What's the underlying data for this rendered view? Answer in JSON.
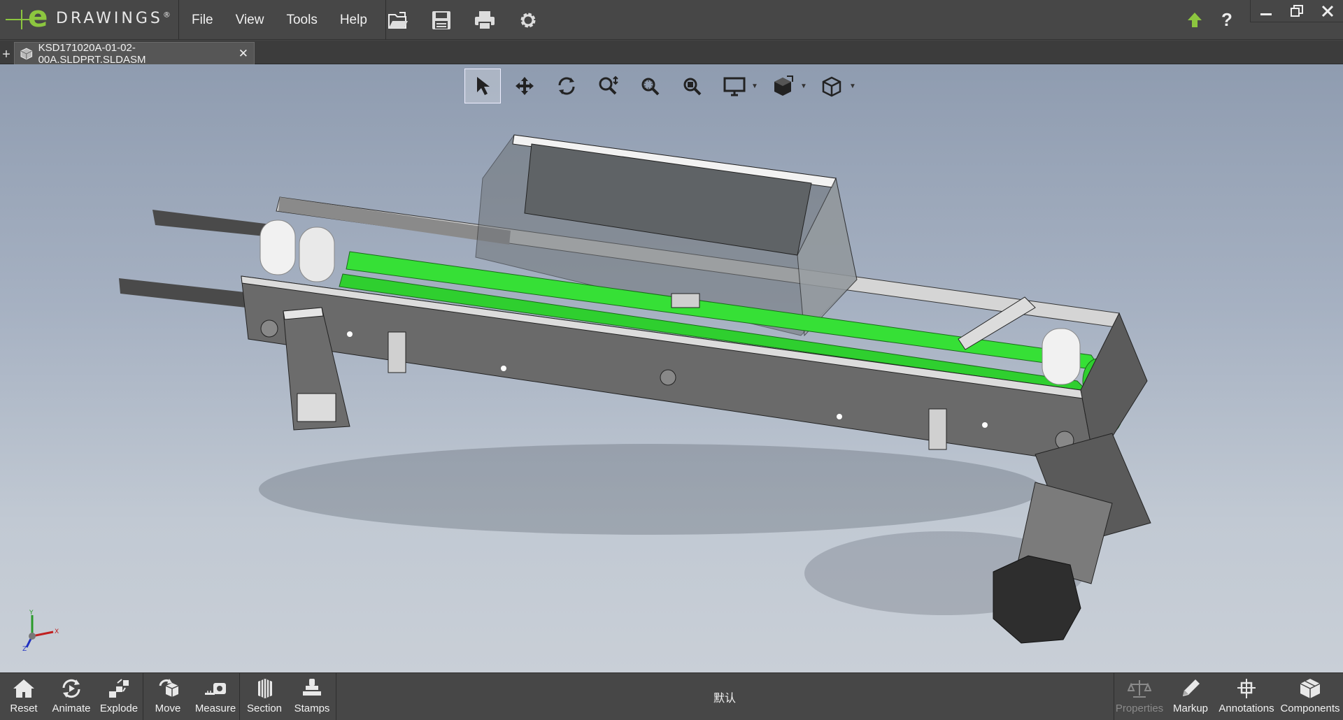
{
  "app": {
    "logo_letter": "e",
    "logo_word": "DRAWINGS",
    "logo_mark": "®"
  },
  "menu": [
    {
      "label": "File"
    },
    {
      "label": "View"
    },
    {
      "label": "Tools"
    },
    {
      "label": "Help"
    }
  ],
  "file_tools": [
    "open-icon",
    "save-icon",
    "print-icon",
    "settings-gear-icon"
  ],
  "window": {
    "help_label": "?",
    "update_icon": "up-arrow-icon"
  },
  "tab": {
    "filename": "KSD171020A-01-02-00A.SLDPRT.SLDASM",
    "close_glyph": "✕",
    "new_tab_glyph": "+"
  },
  "view_toolbar": {
    "tools": [
      "select-arrow-icon",
      "pan-icon",
      "rotate-icon",
      "zoom-icon",
      "zoom-to-area-icon",
      "zoom-to-fit-icon",
      "display-style-icon",
      "view-orientation-icon",
      "standard-views-icon"
    ],
    "active": "select-arrow-icon"
  },
  "triad": {
    "x": "X",
    "y": "Y",
    "z": "Z"
  },
  "bottom_toolbar": {
    "left": [
      {
        "label": "Reset"
      },
      {
        "label": "Animate"
      },
      {
        "label": "Explode"
      },
      {
        "label": "Move"
      },
      {
        "label": "Measure"
      },
      {
        "label": "Section"
      },
      {
        "label": "Stamps"
      }
    ],
    "configuration": "默认",
    "right": [
      {
        "label": "Properties",
        "enabled": false
      },
      {
        "label": "Markup",
        "enabled": true
      },
      {
        "label": "Annotations",
        "enabled": true
      },
      {
        "label": "Components",
        "enabled": true
      }
    ]
  },
  "colors": {
    "belt": "#3fe03f",
    "frame": "#666666",
    "chrome": "#474747",
    "logo_green": "#8cc63f"
  }
}
